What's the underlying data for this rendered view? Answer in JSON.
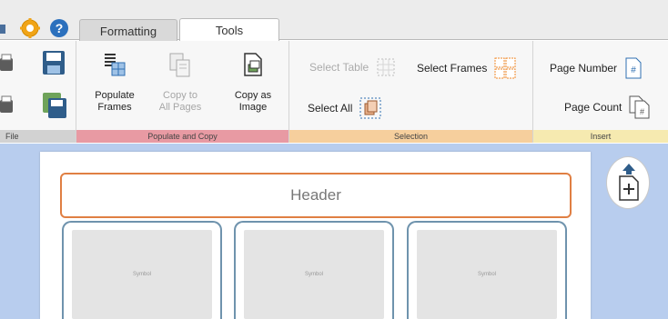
{
  "tabs": [
    {
      "label": "Formatting",
      "active": false
    },
    {
      "label": "Tools",
      "active": true
    }
  ],
  "quick_access": [
    {
      "icon": "settings-gear-icon",
      "color": "#f0a417"
    },
    {
      "icon": "help-icon",
      "color": "#2b70bd"
    }
  ],
  "ribbon": {
    "file_group": {
      "label": "File"
    },
    "populate_group": {
      "label": "Populate and Copy",
      "buttons": [
        {
          "label": "Populate Frames",
          "icon": "populate-frames-icon",
          "enabled": true
        },
        {
          "label": "Copy to All Pages",
          "icon": "copy-to-pages-icon",
          "enabled": false
        },
        {
          "label": "Copy as Image",
          "icon": "copy-image-icon",
          "enabled": true
        }
      ]
    },
    "selection_group": {
      "label": "Selection",
      "select_table": {
        "label": "Select Table",
        "enabled": false
      },
      "select_frames": {
        "label": "Select Frames",
        "enabled": true
      },
      "select_all": {
        "label": "Select All",
        "enabled": true
      }
    },
    "insert_group": {
      "label": "Insert",
      "page_number": {
        "label": "Page Number"
      },
      "page_count": {
        "label": "Page Count"
      }
    }
  },
  "document": {
    "header_text": "Header",
    "frames": [
      {
        "label": "Symbol"
      },
      {
        "label": "Symbol"
      },
      {
        "label": "Symbol"
      }
    ]
  },
  "colors": {
    "populate_group": "#e89aa3",
    "selection_group": "#f6cf9d",
    "insert_group": "#f6eab0",
    "canvas_background": "#b8cdee",
    "header_border": "#e07f43",
    "frame_border": "#6f93ad"
  }
}
